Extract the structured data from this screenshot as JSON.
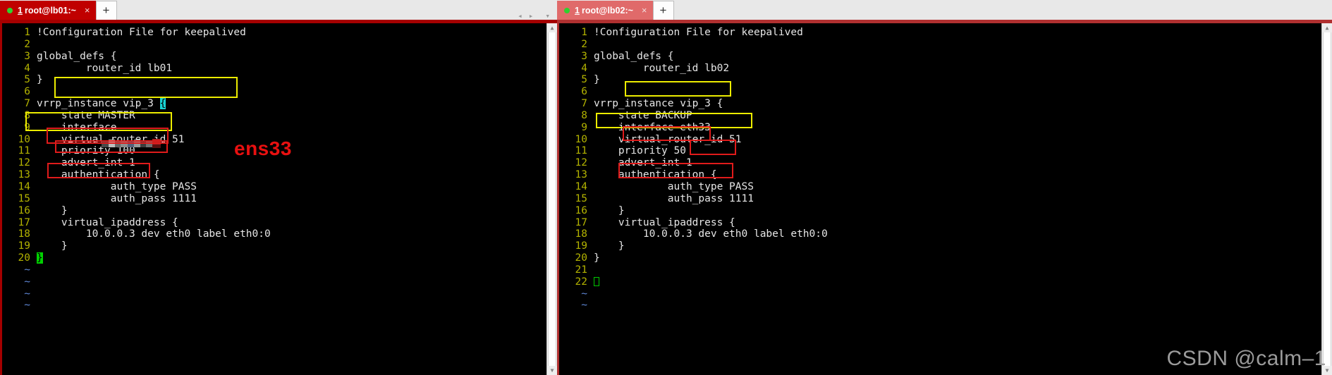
{
  "window_left": {
    "tab": {
      "number": "1",
      "title": "root@lb01:~",
      "close_label": "×",
      "new_tab_label": "+"
    },
    "nav": {
      "prev": "◂",
      "next": "▸",
      "menu": "▾"
    },
    "editor": {
      "lines": [
        {
          "n": "1",
          "text": "!Configuration File for keepalived"
        },
        {
          "n": "2",
          "text": ""
        },
        {
          "n": "3",
          "text": "global_defs {"
        },
        {
          "n": "4",
          "text": "        router_id lb01"
        },
        {
          "n": "5",
          "text": "}"
        },
        {
          "n": "6",
          "text": ""
        },
        {
          "n": "7",
          "text": "vrrp_instance vip_3 {"
        },
        {
          "n": "8",
          "text": "    state MASTER"
        },
        {
          "n": "9",
          "text": "    interface"
        },
        {
          "n": "10",
          "text": "    virtual_router_id 51"
        },
        {
          "n": "11",
          "text": "    priority 100"
        },
        {
          "n": "12",
          "text": "    advert_int 1"
        },
        {
          "n": "13",
          "text": "    authentication {"
        },
        {
          "n": "14",
          "text": "            auth_type PASS"
        },
        {
          "n": "15",
          "text": "            auth_pass 1111"
        },
        {
          "n": "16",
          "text": "    }"
        },
        {
          "n": "17",
          "text": "    virtual_ipaddress {"
        },
        {
          "n": "18",
          "text": "        10.0.0.3 dev eth0 label eth0:0"
        },
        {
          "n": "19",
          "text": "    }"
        },
        {
          "n": "20",
          "text": "}"
        }
      ],
      "empty_marks": [
        "~",
        "~",
        "~",
        "~"
      ],
      "cursor_line7_char": "{",
      "cursor_line20_char": "}"
    },
    "annotation_label": "ens33"
  },
  "window_right": {
    "tab": {
      "number": "1",
      "title": "root@lb02:~",
      "close_label": "×",
      "new_tab_label": "+"
    },
    "editor": {
      "lines": [
        {
          "n": "1",
          "text": "!Configuration File for keepalived"
        },
        {
          "n": "2",
          "text": ""
        },
        {
          "n": "3",
          "text": "global_defs {"
        },
        {
          "n": "4",
          "text": "        router_id lb02"
        },
        {
          "n": "5",
          "text": "}"
        },
        {
          "n": "6",
          "text": ""
        },
        {
          "n": "7",
          "text": "vrrp_instance vip_3 {"
        },
        {
          "n": "8",
          "text": "    state BACKUP"
        },
        {
          "n": "9",
          "text": "    interface eth33"
        },
        {
          "n": "10",
          "text": "    virtual_router_id 51"
        },
        {
          "n": "11",
          "text": "    priority 50"
        },
        {
          "n": "12",
          "text": "    advert_int 1"
        },
        {
          "n": "13",
          "text": "    authentication {"
        },
        {
          "n": "14",
          "text": "            auth_type PASS"
        },
        {
          "n": "15",
          "text": "            auth_pass 1111"
        },
        {
          "n": "16",
          "text": "    }"
        },
        {
          "n": "17",
          "text": "    virtual_ipaddress {"
        },
        {
          "n": "18",
          "text": "        10.0.0.3 dev eth0 label eth0:0"
        },
        {
          "n": "19",
          "text": "    }"
        },
        {
          "n": "20",
          "text": "}"
        },
        {
          "n": "21",
          "text": ""
        },
        {
          "n": "22",
          "text": ""
        }
      ],
      "empty_marks": [
        "~",
        "~"
      ]
    }
  },
  "watermark": "CSDN @calm–1",
  "colors": {
    "tab_active": "#c00000",
    "tab_inactive": "#e06a6a",
    "terminal_bg": "#000000",
    "line_number": "#b3b300",
    "code_text": "#e6e6e6",
    "tilde": "#5f87d7",
    "anno_red": "#e01b1b",
    "anno_yellow": "#ecec00",
    "cursor_green": "#00d000",
    "cursor_cyan": "#19d3d3",
    "label_red": "#e81010"
  }
}
